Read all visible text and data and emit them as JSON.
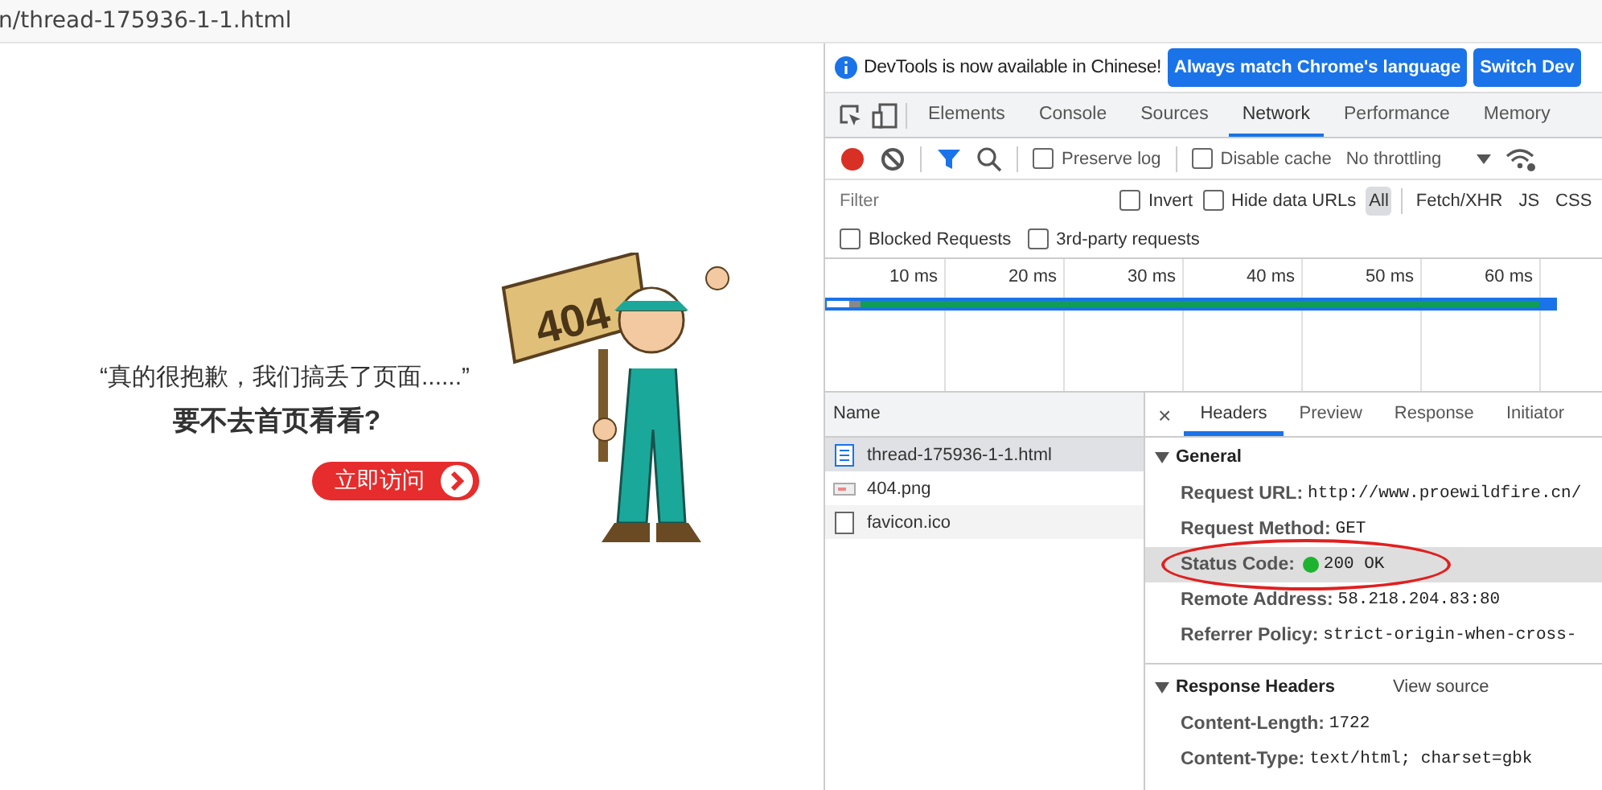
{
  "address_bar": {
    "url": "n/thread-175936-1-1.html"
  },
  "page": {
    "message": "“真的很抱歉，我们搞丢了页面......”",
    "question": "要不去首页看看?",
    "button": "立即访问",
    "illustration": {
      "sign_text": "404"
    }
  },
  "devtools": {
    "infobar": {
      "message": "DevTools is now available in Chinese!",
      "buttons": [
        "Always match Chrome's language",
        "Switch Dev"
      ]
    },
    "tabs": [
      {
        "label": "Elements",
        "selected": false
      },
      {
        "label": "Console",
        "selected": false
      },
      {
        "label": "Sources",
        "selected": false
      },
      {
        "label": "Network",
        "selected": true
      },
      {
        "label": "Performance",
        "selected": false
      },
      {
        "label": "Memory",
        "selected": false
      }
    ],
    "toolbar": {
      "recording": true,
      "checkboxes": [
        {
          "label": "Preserve log",
          "checked": false
        },
        {
          "label": "Disable cache",
          "checked": false
        }
      ],
      "throttling": "No throttling"
    },
    "filter": {
      "placeholder": "Filter",
      "checkboxes": [
        {
          "label": "Invert",
          "checked": false
        },
        {
          "label": "Hide data URLs",
          "checked": false
        }
      ],
      "types": [
        {
          "label": "All",
          "selected": true
        },
        {
          "label": "Fetch/XHR",
          "selected": false
        },
        {
          "label": "JS",
          "selected": false
        },
        {
          "label": "CSS",
          "selected": false
        }
      ]
    },
    "extra_filters": [
      {
        "label": "Blocked Requests",
        "checked": false
      },
      {
        "label": "3rd-party requests",
        "checked": false
      }
    ],
    "timeline": {
      "ticks": [
        "10 ms",
        "20 ms",
        "30 ms",
        "40 ms",
        "50 ms",
        "60 ms"
      ]
    },
    "requests": {
      "column": "Name",
      "rows": [
        {
          "name": "thread-175936-1-1.html",
          "kind": "document",
          "selected": true
        },
        {
          "name": "404.png",
          "kind": "image",
          "selected": false
        },
        {
          "name": "favicon.ico",
          "kind": "other",
          "selected": false
        }
      ]
    },
    "details": {
      "close": "×",
      "tabs": [
        {
          "label": "Headers",
          "selected": true
        },
        {
          "label": "Preview",
          "selected": false
        },
        {
          "label": "Response",
          "selected": false
        },
        {
          "label": "Initiator",
          "selected": false
        }
      ],
      "sections": [
        {
          "title": "General",
          "expanded": true,
          "rows": [
            {
              "key": "Request URL:",
              "value": "http://www.proewildfire.cn/",
              "kind": "plain",
              "highlighted": false,
              "circled": false
            },
            {
              "key": "Request Method:",
              "value": "GET",
              "kind": "plain",
              "highlighted": false,
              "circled": false
            },
            {
              "key": "Status Code:",
              "value": "200 OK",
              "kind": "status",
              "highlighted": true,
              "circled": true
            },
            {
              "key": "Remote Address:",
              "value": "58.218.204.83:80",
              "kind": "plain",
              "highlighted": false,
              "circled": false
            },
            {
              "key": "Referrer Policy:",
              "value": "strict-origin-when-cross-",
              "kind": "plain",
              "highlighted": false,
              "circled": false
            }
          ]
        },
        {
          "title": "Response Headers",
          "expanded": true,
          "action": "View source",
          "rows": [
            {
              "key": "Content-Length:",
              "value": "1722",
              "kind": "plain",
              "highlighted": false,
              "circled": false
            },
            {
              "key": "Content-Type:",
              "value": "text/html; charset=gbk",
              "kind": "plain",
              "highlighted": false,
              "circled": false
            }
          ]
        }
      ]
    }
  }
}
